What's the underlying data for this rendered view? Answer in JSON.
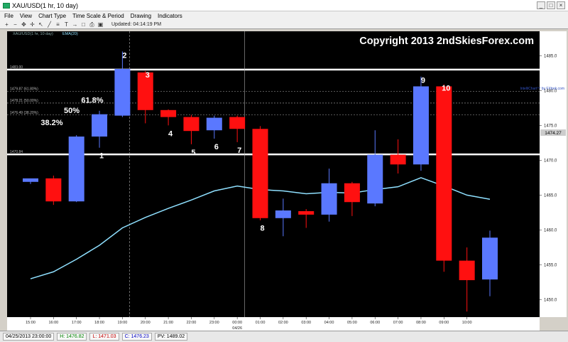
{
  "window": {
    "title": "XAU/USD(1 hr, 10 day)",
    "controls": [
      "_",
      "□",
      "×"
    ]
  },
  "menu": [
    "File",
    "View",
    "Chart Type",
    "Time Scale & Period",
    "Drawing",
    "Indicators"
  ],
  "toolbar": {
    "icons": [
      "zoom-in-icon",
      "zoom-out-icon",
      "pan-icon",
      "crosshair-icon",
      "cursor-icon",
      "trend-line-icon",
      "fibonacci-icon",
      "text-icon",
      "arrow-icon",
      "shape-icon",
      "print-icon",
      "save-icon"
    ],
    "updated_label": "Updated: 04:14:19 PM"
  },
  "chart_data": {
    "type": "candlestick",
    "title": "XAU/USD(1 hr, 10 day)",
    "legend": {
      "instrument": "XAU/USD(1 hr, 10 day)",
      "indicator": "EMA(20)",
      "placement": "top-left"
    },
    "watermark": "Copyright 2013 2ndSkiesForex.com",
    "credit": "IntelliChart™ by FXtrek.com",
    "date_marker": "04/26",
    "last_price_label": "1474.27",
    "ylim": [
      1447.5,
      1488.5
    ],
    "y_ticks": [
      1450.0,
      1455.0,
      1460.0,
      1465.0,
      1470.0,
      1475.0,
      1480.0,
      1485.0
    ],
    "x_ticks": [
      "15:00",
      "16:00",
      "17:00",
      "18:00",
      "19:00",
      "20:00",
      "21:00",
      "22:00",
      "23:00",
      "00:00",
      "01:00",
      "02:00",
      "03:00",
      "04:00",
      "05:00",
      "06:00",
      "07:00",
      "08:00",
      "09:00",
      "10:00"
    ],
    "candles": [
      {
        "t": "14:00",
        "o": 1466.9,
        "h": 1467.3,
        "l": 1466.6,
        "c": 1467.4
      },
      {
        "t": "15:00",
        "o": 1467.4,
        "h": 1467.8,
        "l": 1463.6,
        "c": 1464.1
      },
      {
        "t": "16:00",
        "o": 1464.1,
        "h": 1473.6,
        "l": 1464.0,
        "c": 1473.4
      },
      {
        "t": "17:00",
        "o": 1473.4,
        "h": 1477.1,
        "l": 1471.8,
        "c": 1476.6
      },
      {
        "t": "18:00",
        "o": 1476.4,
        "h": 1485.6,
        "l": 1476.2,
        "c": 1483.1
      },
      {
        "t": "19:00",
        "o": 1482.6,
        "h": 1482.8,
        "l": 1475.3,
        "c": 1477.2
      },
      {
        "t": "20:00",
        "o": 1477.2,
        "h": 1477.3,
        "l": 1475.0,
        "c": 1476.2
      },
      {
        "t": "21:00",
        "o": 1476.2,
        "h": 1476.5,
        "l": 1472.3,
        "c": 1474.2
      },
      {
        "t": "22:00",
        "o": 1474.3,
        "h": 1476.4,
        "l": 1473.1,
        "c": 1476.1
      },
      {
        "t": "23:00",
        "o": 1476.2,
        "h": 1476.4,
        "l": 1472.6,
        "c": 1474.5
      },
      {
        "t": "00:00",
        "o": 1474.5,
        "h": 1474.9,
        "l": 1461.4,
        "c": 1461.7
      },
      {
        "t": "01:00",
        "o": 1461.7,
        "h": 1464.5,
        "l": 1459.1,
        "c": 1462.8
      },
      {
        "t": "02:00",
        "o": 1462.7,
        "h": 1463.0,
        "l": 1460.3,
        "c": 1462.2
      },
      {
        "t": "03:00",
        "o": 1462.2,
        "h": 1468.8,
        "l": 1461.2,
        "c": 1466.7
      },
      {
        "t": "04:00",
        "o": 1466.7,
        "h": 1466.9,
        "l": 1462.0,
        "c": 1464.0
      },
      {
        "t": "05:00",
        "o": 1463.8,
        "h": 1474.3,
        "l": 1463.4,
        "c": 1470.8
      },
      {
        "t": "06:00",
        "o": 1470.8,
        "h": 1473.0,
        "l": 1468.1,
        "c": 1469.4
      },
      {
        "t": "07:00",
        "o": 1469.4,
        "h": 1482.0,
        "l": 1468.5,
        "c": 1480.6
      },
      {
        "t": "08:00",
        "o": 1480.6,
        "h": 1480.9,
        "l": 1454.0,
        "c": 1455.6
      },
      {
        "t": "09:00",
        "o": 1455.6,
        "h": 1457.5,
        "l": 1448.3,
        "c": 1452.8
      },
      {
        "t": "10:00",
        "o": 1452.9,
        "h": 1459.9,
        "l": 1450.5,
        "c": 1458.9
      }
    ],
    "ema": [
      1453.0,
      1454.0,
      1455.8,
      1457.8,
      1460.3,
      1461.8,
      1463.1,
      1464.3,
      1465.6,
      1466.3,
      1465.8,
      1465.6,
      1465.2,
      1465.4,
      1465.3,
      1465.8,
      1466.2,
      1467.5,
      1466.3,
      1465.0,
      1464.4
    ],
    "horizontal_levels": [
      {
        "value": 1483.0,
        "style": "solid",
        "label": "1483.00"
      },
      {
        "value": 1479.87,
        "style": "dashed",
        "label": "1479.87 (61.80%)"
      },
      {
        "value": 1478.21,
        "style": "dashed",
        "label": "1478.21 (50.00%)"
      },
      {
        "value": 1476.49,
        "style": "dashed",
        "label": "1476.49 (38.20%)"
      },
      {
        "value": 1470.84,
        "style": "solid",
        "label": "1470.84"
      }
    ],
    "vertical_markers": [
      "18:00",
      "23:00"
    ],
    "annotations": [
      {
        "text": "1",
        "at": "17:00",
        "anchor": "low"
      },
      {
        "text": "2",
        "at": "18:00",
        "anchor": "high"
      },
      {
        "text": "3",
        "at": "19:00",
        "anchor": "high"
      },
      {
        "text": "4",
        "at": "20:00",
        "anchor": "low"
      },
      {
        "text": "5",
        "at": "21:00",
        "anchor": "low"
      },
      {
        "text": "6",
        "at": "22:00",
        "anchor": "low"
      },
      {
        "text": "7",
        "at": "23:00",
        "anchor": "low"
      },
      {
        "text": "8",
        "at": "00:00",
        "anchor": "low"
      },
      {
        "text": "9",
        "at": "07:00",
        "anchor": "high"
      },
      {
        "text": "10",
        "at": "08:00",
        "anchor": "high"
      }
    ],
    "fib_labels": [
      "38.2%",
      "50%",
      "61.8%"
    ]
  },
  "status": {
    "date": "04/25/2013 23:00:00",
    "high": "H: 1476.82",
    "low": "L: 1471.03",
    "close": "C: 1476.23",
    "pv": "PV: 1489.02"
  },
  "colors": {
    "bull": "#5a78ff",
    "bear": "#ff1010",
    "ema": "#8fe0ff",
    "background": "#000000"
  }
}
